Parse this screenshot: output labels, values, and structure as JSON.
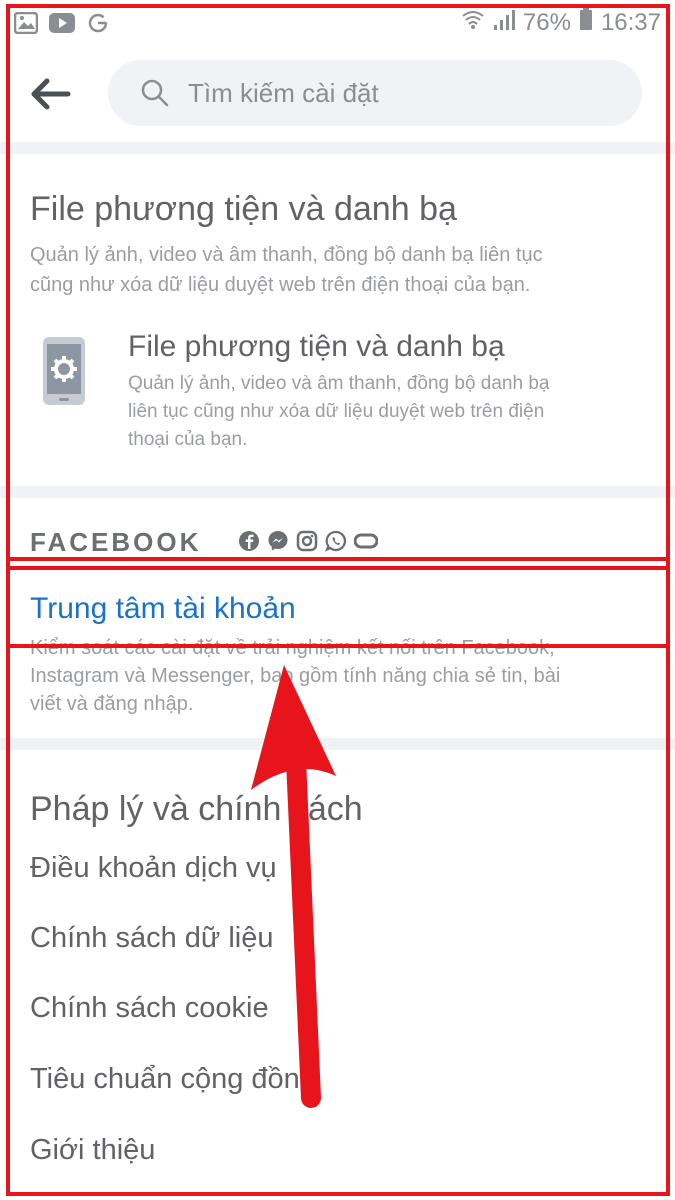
{
  "status_bar": {
    "left_icons": [
      "gallery-icon",
      "youtube-icon",
      "google-icon"
    ],
    "battery": "76%",
    "time": "16:37"
  },
  "header": {
    "search_placeholder": "Tìm kiếm cài đặt"
  },
  "media_section": {
    "title": "File phương tiện và danh bạ",
    "description_line1": "Quản lý ảnh, video và âm thanh, đồng bộ danh bạ liên tục",
    "description_line2": "cũng như xóa dữ liệu duyệt web trên điện thoại của bạn.",
    "item": {
      "title": "File phương tiện và danh bạ",
      "description_line1": "Quản lý ảnh, video và âm thanh, đồng bộ danh bạ",
      "description_line2": "liên tục cũng như xóa dữ liệu duyệt web trên điện",
      "description_line3": "thoại của bạn."
    }
  },
  "facebook_label": "FACEBOOK",
  "account_center": {
    "title": "Trung tâm tài khoản",
    "description_line1": "Kiểm soát các cài đặt về trải nghiệm kết nối trên Facebook,",
    "description_line2": "Instagram và Messenger, bao gồm tính năng chia sẻ tin, bài",
    "description_line3": "viết và đăng nhập."
  },
  "legal": {
    "title": "Pháp lý và chính sách",
    "items": [
      "Điều khoản dịch vụ",
      "Chính sách dữ liệu",
      "Chính sách cookie",
      "Tiêu chuẩn cộng đồng",
      "Giới thiệu"
    ]
  },
  "colors": {
    "annotation_red": "#e8141c",
    "link_blue": "#1a73c9"
  }
}
